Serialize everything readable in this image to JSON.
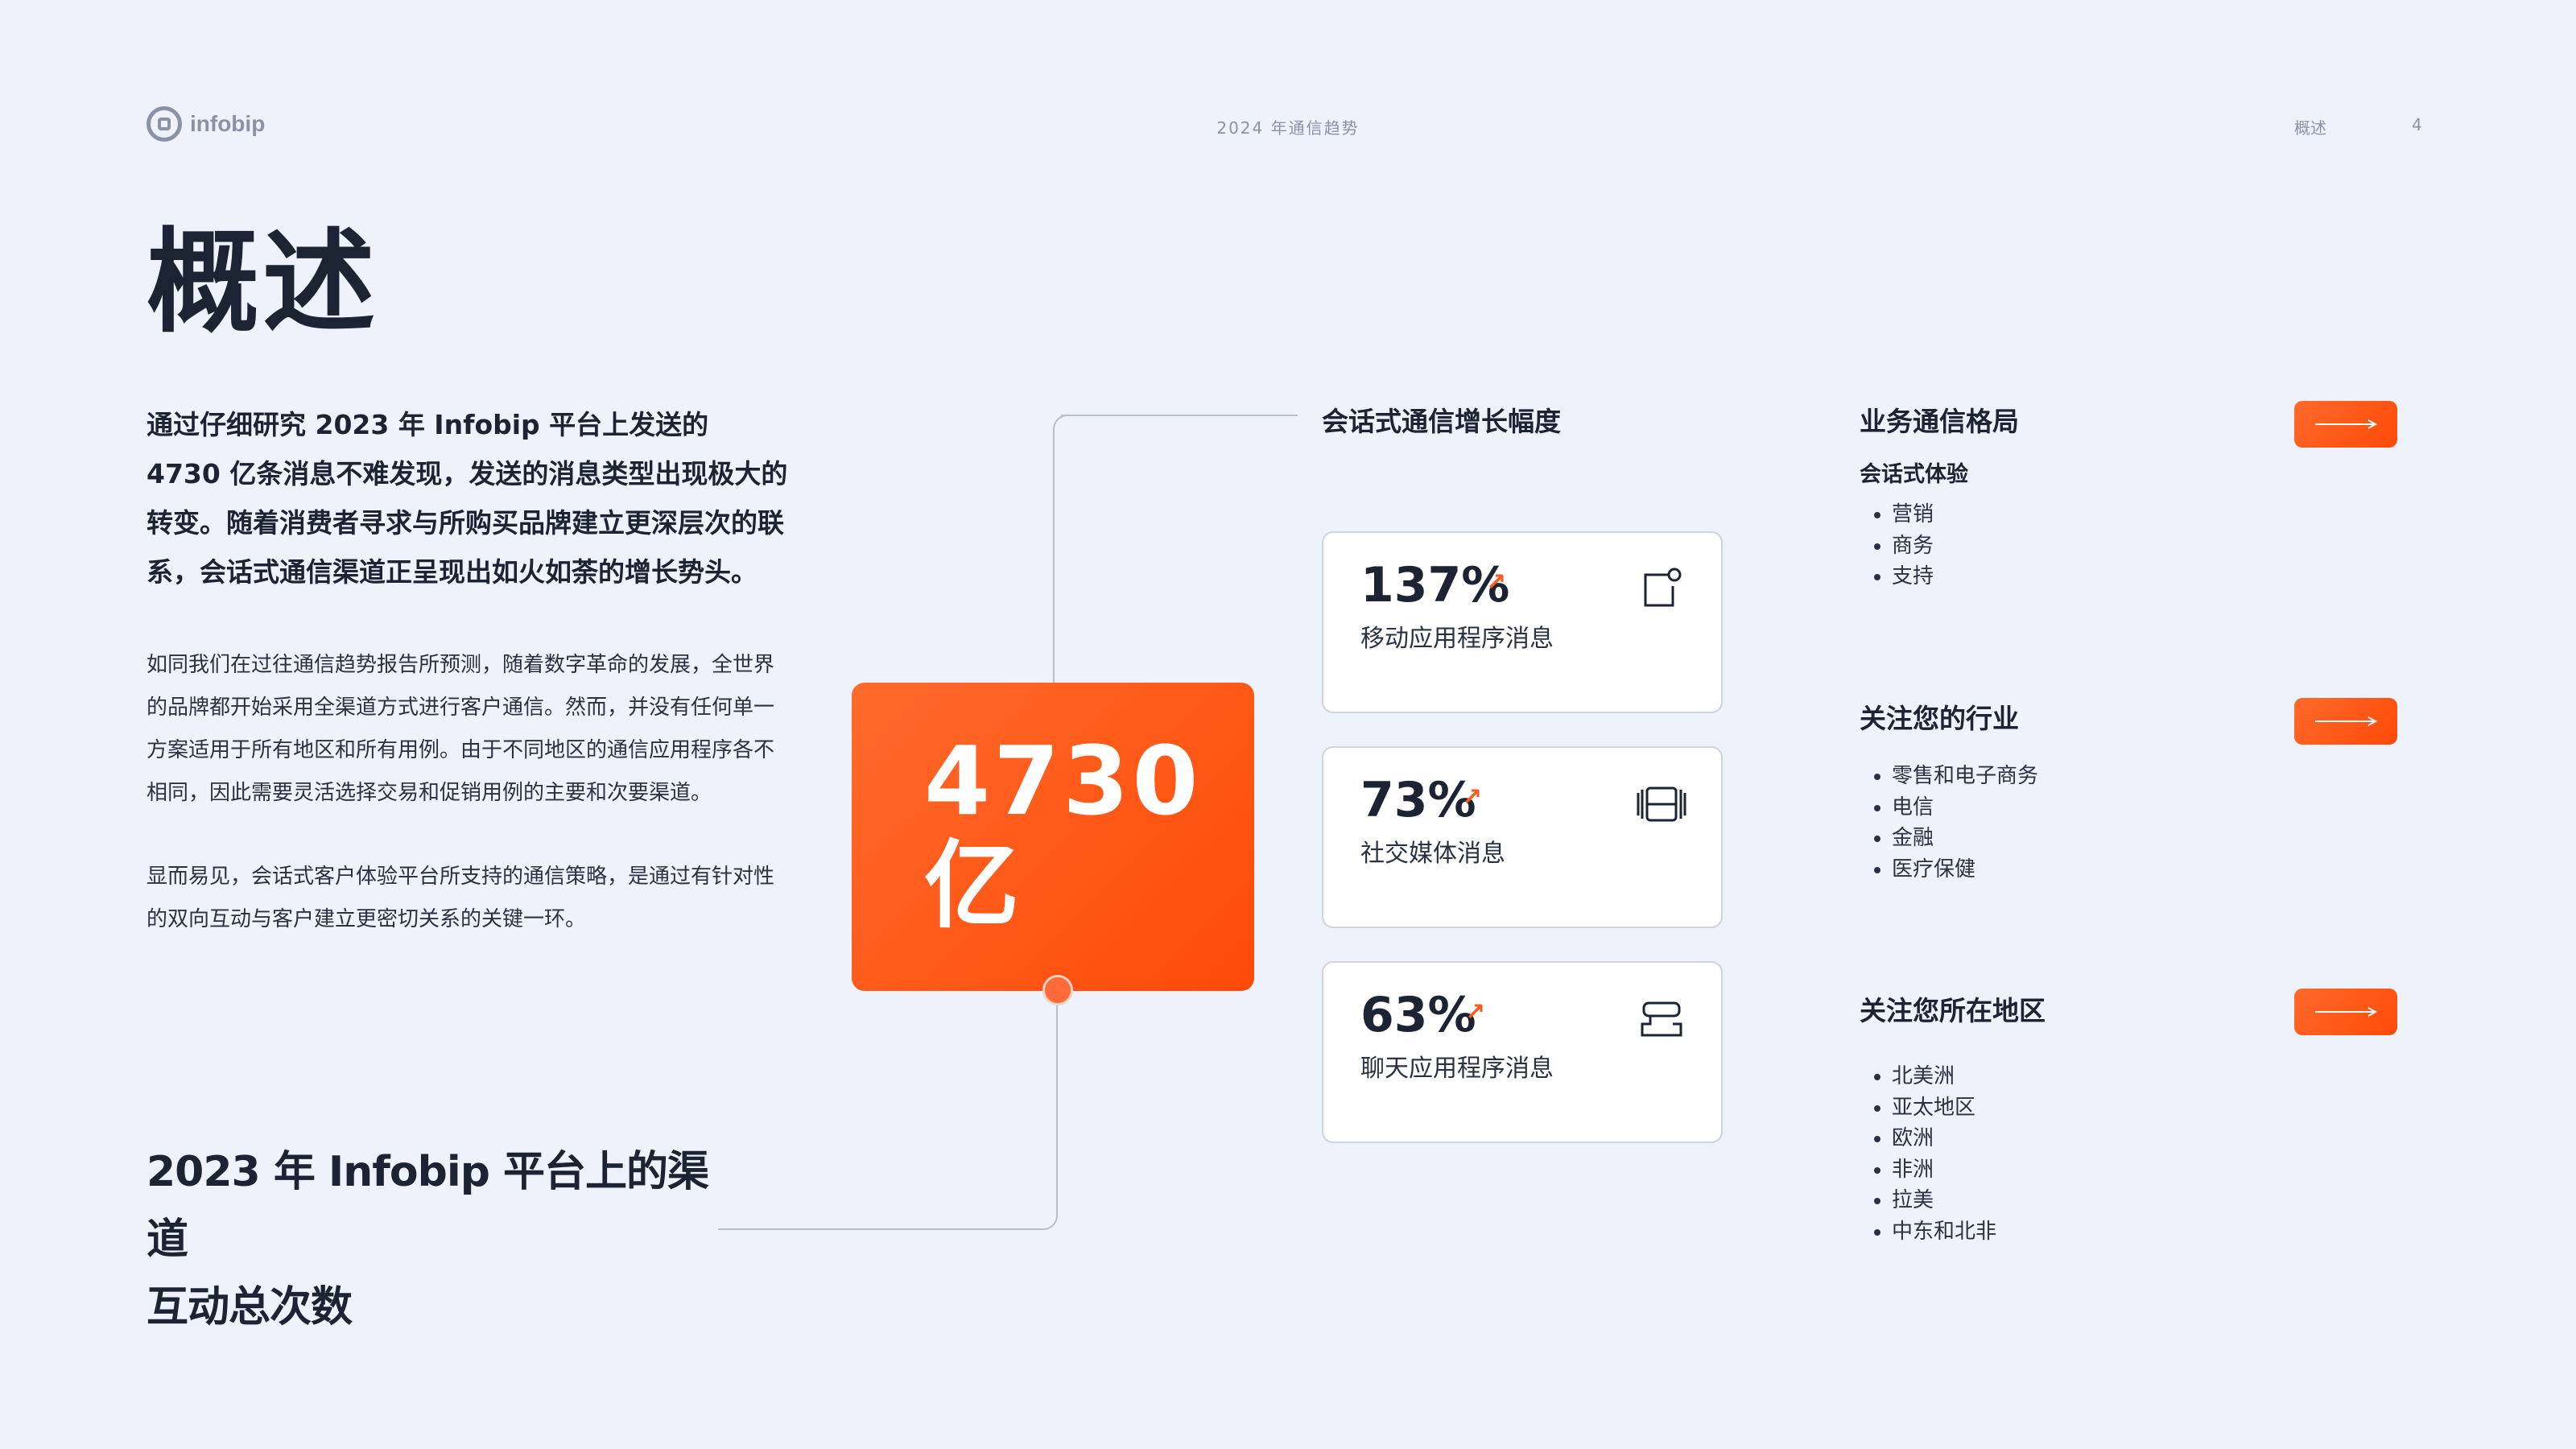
{
  "header": {
    "logo_text": "infobip",
    "report_title": "2024 年通信趋势",
    "section": "概述",
    "page_number": "4"
  },
  "page_title": "概述",
  "intro": "通过仔细研究 2023 年 Infobip 平台上发送的 4730 亿条消息不难发现，发送的消息类型出现极大的转变。随着消费者寻求与所购买品牌建立更深层次的联系，会话式通信渠道正呈现出如火如荼的增长势头。",
  "paragraphs": [
    "如同我们在过往通信趋势报告所预测，随着数字革命的发展，全世界的品牌都开始采用全渠道方式进行客户通信。然而，并没有任何单一方案适用于所有地区和所有用例。由于不同地区的通信应用程序各不相同，因此需要灵活选择交易和促销用例的主要和次要渠道。",
    "显而易见，会话式客户体验平台所支持的通信策略，是通过有针对性的双向互动与客户建立更密切关系的关键一环。"
  ],
  "bottom_label": {
    "line1": "2023 年 Infobip 平台上的渠道",
    "line2": "互动总次数"
  },
  "highlight": {
    "number": "4730",
    "unit": "亿",
    "color": "#ff5a1f"
  },
  "growth": {
    "title": "会话式通信增长幅度",
    "items": [
      {
        "value": "137%",
        "label": "移动应用程序消息",
        "icon": "mobile-app-icon"
      },
      {
        "value": "73%",
        "label": "社交媒体消息",
        "icon": "social-media-icon"
      },
      {
        "value": "63%",
        "label": "聊天应用程序消息",
        "icon": "chat-app-icon"
      }
    ]
  },
  "sidebar": [
    {
      "title": "业务通信格局",
      "subtitle": "会话式体验",
      "items": [
        "营销",
        "商务",
        "支持"
      ]
    },
    {
      "title": "关注您的行业",
      "subtitle": "",
      "items": [
        "零售和电子商务",
        "电信",
        "金融",
        "医疗保健"
      ]
    },
    {
      "title": "关注您所在地区",
      "subtitle": "",
      "items": [
        "北美洲",
        "亚太地区",
        "欧洲",
        "非洲",
        "拉美",
        "中东和北非"
      ]
    }
  ]
}
